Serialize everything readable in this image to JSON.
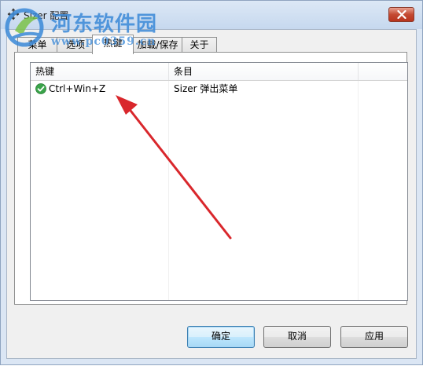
{
  "window": {
    "title": "Sizer 配置",
    "close_label": "×"
  },
  "tabs": [
    {
      "label": "菜单",
      "active": false
    },
    {
      "label": "选项",
      "active": false
    },
    {
      "label": "热键",
      "active": true
    },
    {
      "label": "加载/保存",
      "active": false
    },
    {
      "label": "关于",
      "active": false
    }
  ],
  "hotkey_list": {
    "columns": [
      "热键",
      "条目",
      ""
    ],
    "rows": [
      {
        "hotkey": "Ctrl+Win+Z",
        "item": "Sizer 弹出菜单",
        "status_icon": "check-icon"
      }
    ]
  },
  "buttons": {
    "ok": "确定",
    "cancel": "取消",
    "apply": "应用"
  },
  "watermark": {
    "text": "河东软件园",
    "url": "www.pc0359.cn"
  },
  "colors": {
    "accent": "#3c7fb1",
    "check_green": "#3aa44a",
    "arrow_red": "#d9272c",
    "watermark_blue": "#3a89d8"
  }
}
